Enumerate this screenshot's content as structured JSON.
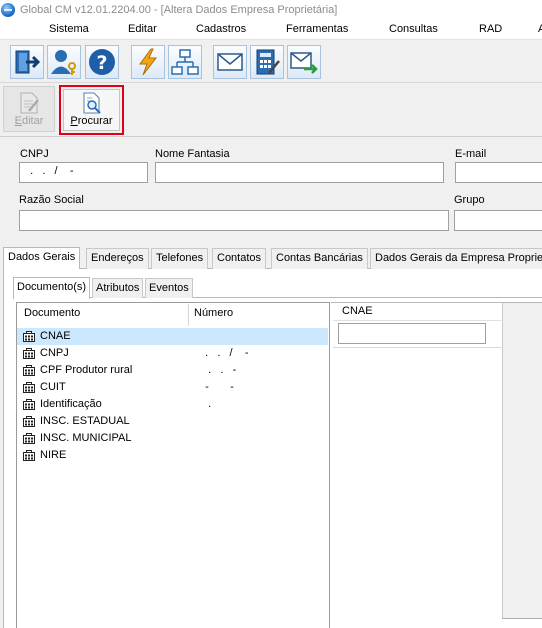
{
  "window": {
    "title": "Global CM v12.01.2204.00 - [Altera Dados Empresa Proprietária]"
  },
  "menu": [
    "Sistema",
    "Editar",
    "Cadastros",
    "Ferramentas",
    "Consultas",
    "RAD",
    "A"
  ],
  "toolbar": [
    "exit-icon",
    "user-key-icon",
    "help-icon",
    "lightning-icon",
    "network-icon",
    "mail-icon",
    "calculator-icon",
    "mail-export-icon"
  ],
  "actions": {
    "editar_prefix": "",
    "editar_key": "E",
    "editar_rest": "ditar",
    "procurar_key": "P",
    "procurar_rest": "rocurar"
  },
  "form": {
    "cnpj_label": "CNPJ",
    "cnpj_value": "  .   .   /    -",
    "nome_fantasia_label": "Nome Fantasia",
    "email_label": "E-mail",
    "razao_social_label": "Razão Social",
    "grupo_label": "Grupo"
  },
  "tabs": [
    "Dados Gerais",
    "Endereços",
    "Telefones",
    "Contatos",
    "Contas Bancárias",
    "Dados Gerais da Empresa Proprie"
  ],
  "subtabs": [
    "Documento(s)",
    "Atributos",
    "Eventos"
  ],
  "documents": {
    "col_documento": "Documento",
    "col_numero": "Número",
    "rows": [
      {
        "name": "CNAE",
        "number": "",
        "selected": true
      },
      {
        "name": "CNPJ",
        "number": "  .   .   /    -",
        "selected": false
      },
      {
        "name": "CPF Produtor rural",
        "number": "   .   .   -",
        "selected": false
      },
      {
        "name": "CUIT",
        "number": "  -       -",
        "selected": false
      },
      {
        "name": "Identificação",
        "number": "   .",
        "selected": false
      },
      {
        "name": "INSC. ESTADUAL",
        "number": "",
        "selected": false
      },
      {
        "name": "INSC. MUNICIPAL",
        "number": "",
        "selected": false
      },
      {
        "name": "NIRE",
        "number": "",
        "selected": false
      }
    ]
  },
  "cnae": {
    "label": "CNAE",
    "value": ""
  },
  "colors": {
    "highlight": "#e0001a",
    "selection": "#cce8ff",
    "toolbar_border": "#a9c2de"
  }
}
